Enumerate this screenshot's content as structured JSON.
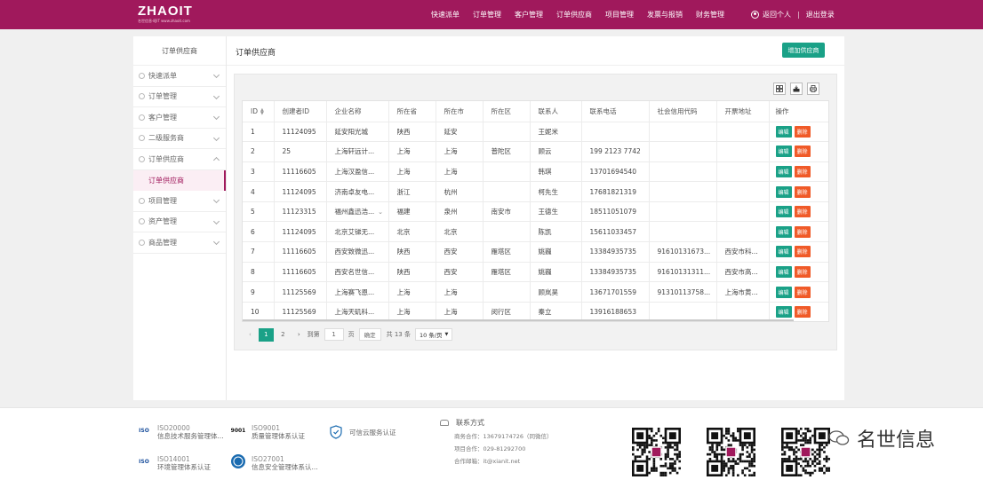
{
  "header": {
    "logo": "ZHAOIT",
    "logo_sub": "名世信息·昭IT  www.zhaoit.com",
    "nav": [
      "快速派单",
      "订单管理",
      "客户管理",
      "订单供应商",
      "项目管理",
      "发票与报销",
      "财务管理"
    ],
    "user_label": "返回个人",
    "logout_label": "退出登录",
    "separator": "|"
  },
  "sidebar": {
    "title": "订单供应商",
    "items": [
      {
        "label": "快速派单"
      },
      {
        "label": "订单管理"
      },
      {
        "label": "客户管理"
      },
      {
        "label": "二级服务商"
      },
      {
        "label": "订单供应商"
      },
      {
        "label": "项目管理"
      },
      {
        "label": "资产管理"
      },
      {
        "label": "商品管理"
      }
    ],
    "active_sub": "订单供应商"
  },
  "main": {
    "title": "订单供应商",
    "add_button": "增加供应商",
    "tools": [
      "grid-icon",
      "export-icon",
      "print-icon"
    ]
  },
  "table": {
    "columns": [
      "ID",
      "创建者ID",
      "企业名称",
      "所在省",
      "所在市",
      "所在区",
      "联系人",
      "联系电话",
      "社会信用代码",
      "开票地址",
      "操作"
    ],
    "edit_label": "编辑",
    "delete_label": "删除",
    "rows": [
      [
        "1",
        "11124095",
        "延安阳光城",
        "陕西",
        "延安",
        "",
        "王妮米",
        "",
        "",
        ""
      ],
      [
        "2",
        "25",
        "上海轩远计...",
        "上海",
        "上海",
        "普陀区",
        "顾云",
        "199 2123 7742",
        "",
        ""
      ],
      [
        "3",
        "11116605",
        "上海汉盈信...",
        "上海",
        "上海",
        "",
        "韩琪",
        "13701694540",
        "",
        ""
      ],
      [
        "4",
        "11124095",
        "济南卓友电...",
        "浙江",
        "杭州",
        "",
        "柯先生",
        "17681821319",
        "",
        ""
      ],
      [
        "5",
        "11123315",
        "福州鑫迅浩...",
        "福建",
        "泉州",
        "南安市",
        "王德生",
        "18511051079",
        "",
        ""
      ],
      [
        "6",
        "11124095",
        "北京艾锑无...",
        "北京",
        "北京",
        "",
        "陈凯",
        "15611033457",
        "",
        ""
      ],
      [
        "7",
        "11116605",
        "西安致微迅...",
        "陕西",
        "西安",
        "雁塔区",
        "姚巍",
        "13384935735",
        "91610131673...",
        "西安市科..."
      ],
      [
        "8",
        "11116605",
        "西安名世信...",
        "陕西",
        "西安",
        "雁塔区",
        "姚巍",
        "13384935735",
        "91610131311...",
        "西安市高..."
      ],
      [
        "9",
        "11125569",
        "上海赛飞恩...",
        "上海",
        "上海",
        "",
        "顾岚昊",
        "13671701559",
        "91310113758...",
        "上海市黄..."
      ],
      [
        "10",
        "11125569",
        "上海天矶科...",
        "上海",
        "上海",
        "闵行区",
        "秦立",
        "13916188653",
        "",
        ""
      ]
    ]
  },
  "pagination": {
    "prev": "‹",
    "pages": [
      "1",
      "2"
    ],
    "active_page": "1",
    "next": "›",
    "goto_label": "到第",
    "goto_value": "1",
    "page_unit": "页",
    "confirm": "确定",
    "total": "共 13 条",
    "page_size": "10 条/页"
  },
  "footer": {
    "certs": [
      {
        "logo": "ISO",
        "title": "ISO20000",
        "desc": "信息技术服务管理体..."
      },
      {
        "logo": "9001",
        "title": "ISO9001",
        "desc": "质量管理体系认证"
      },
      {
        "logo": "",
        "title": "",
        "desc": "可信云服务认证"
      },
      {
        "logo": "ISO",
        "title": "ISO14001",
        "desc": "环境管理体系认证"
      },
      {
        "logo": "",
        "title": "ISO27001",
        "desc": "信息安全管理体系认..."
      }
    ],
    "contact": {
      "title": "联系方式",
      "lines": [
        "商务合作：13679174726（同微信）",
        "项目合作：029-81292700",
        "合作邮箱：it@xianit.net"
      ]
    }
  },
  "watermark": "名世信息",
  "colors": {
    "brand": "#a0195c",
    "accent": "#1aa187",
    "danger": "#f05a28"
  }
}
